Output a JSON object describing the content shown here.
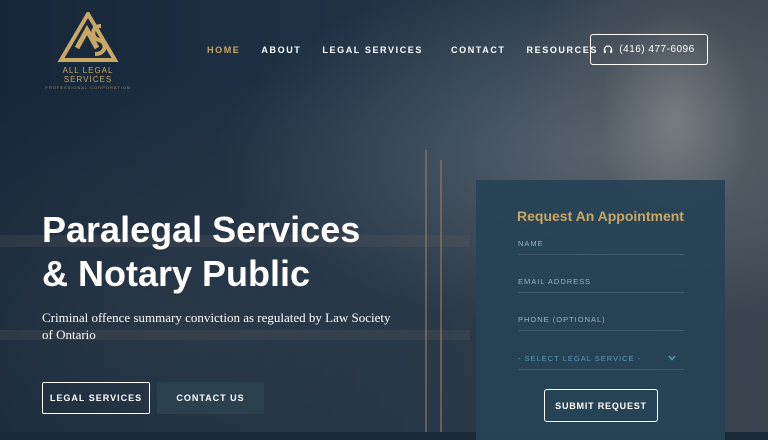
{
  "brand": {
    "name": "ALL LEGAL SERVICES",
    "subtitle": "PROFESSIONAL CORPORATION",
    "color": "#c9a765"
  },
  "nav": {
    "items": [
      {
        "label": "HOME",
        "active": true
      },
      {
        "label": "ABOUT",
        "active": false
      },
      {
        "label": "LEGAL SERVICES",
        "active": false
      },
      {
        "label": "CONTACT",
        "active": false
      },
      {
        "label": "RESOURCES",
        "active": false
      }
    ]
  },
  "phone": {
    "number": "(416) 477-6096",
    "icon": "headset-icon"
  },
  "hero": {
    "title_line1": "Paralegal Services",
    "title_line2": "& Notary Public",
    "subtitle": "Criminal offence summary conviction as regulated by Law Society of Ontario",
    "primary_button": "LEGAL SERVICES",
    "secondary_button": "CONTACT US"
  },
  "appointment_form": {
    "title": "Request An Appointment",
    "name_placeholder": "NAME",
    "email_placeholder": "EMAIL ADDRESS",
    "phone_placeholder": "PHONE (OPTIONAL)",
    "service_select": "- SELECT LEGAL SERVICE -",
    "submit_label": "SUBMIT REQUEST",
    "accent_color": "#c9a765",
    "background_color": "#264356"
  }
}
